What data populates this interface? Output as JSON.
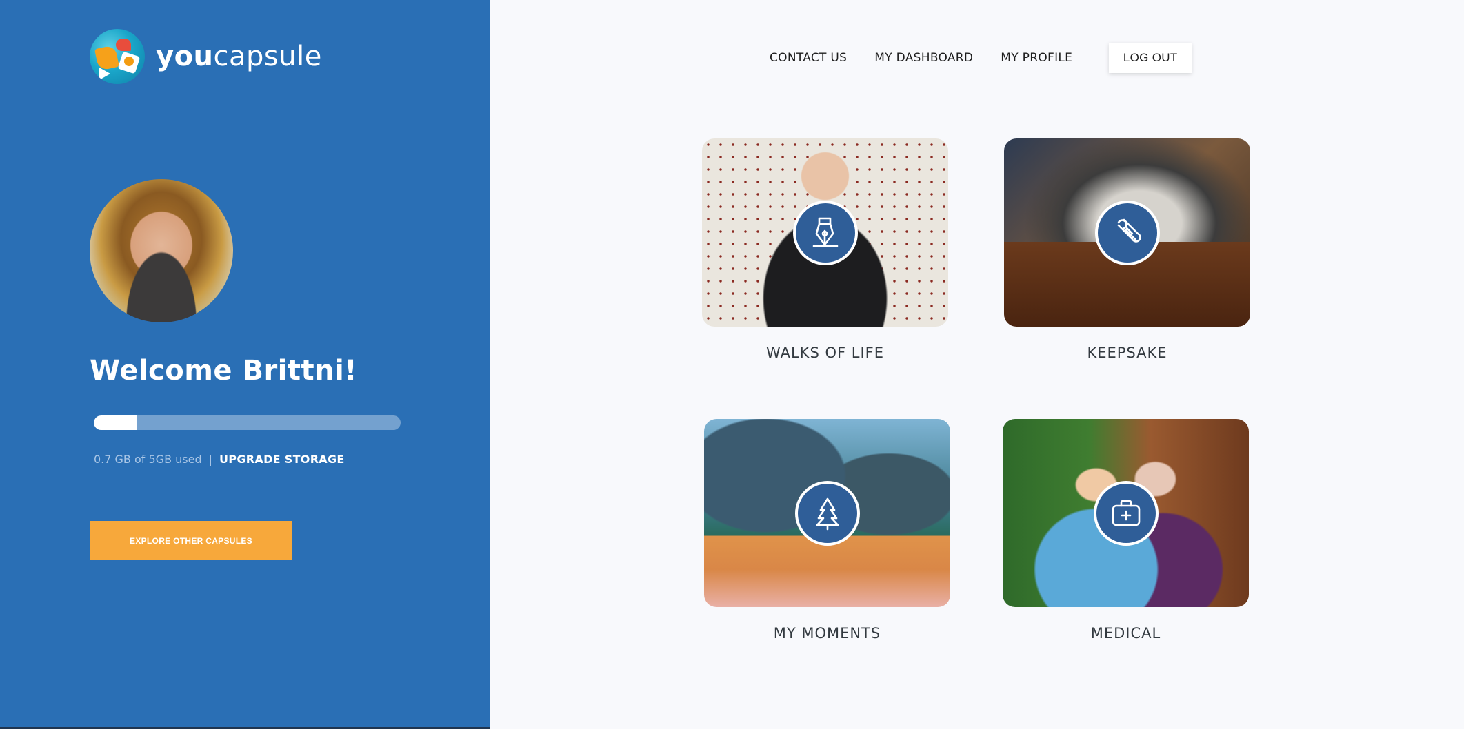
{
  "brand": {
    "name_bold": "you",
    "name_light": "capsule",
    "logo_icon": "globe-logo-icon"
  },
  "profile": {
    "welcome": "Welcome Brittni!",
    "avatar": "user-avatar"
  },
  "storage": {
    "used_fraction": 0.14,
    "used_text": "0.7 GB of 5GB used",
    "separator": "|",
    "upgrade_label": "UPGRADE STORAGE"
  },
  "sidebar": {
    "explore_label": "EXPLORE OTHER CAPSULES"
  },
  "nav": {
    "items": [
      {
        "label": "CONTACT US"
      },
      {
        "label": "MY DASHBOARD"
      },
      {
        "label": "MY PROFILE"
      }
    ],
    "logout_label": "LOG OUT"
  },
  "capsules": [
    {
      "label": "WALKS OF LIFE",
      "icon": "fountain-pen-icon"
    },
    {
      "label": "KEEPSAKE",
      "icon": "scroll-icon"
    },
    {
      "label": "MY MOMENTS",
      "icon": "tree-icon"
    },
    {
      "label": "MEDICAL",
      "icon": "medical-kit-icon"
    }
  ],
  "colors": {
    "sidebar_bg": "#2a6fb5",
    "accent_orange": "#f7a83b",
    "badge_blue": "#2f5e98",
    "page_bg": "#f8f9fc"
  }
}
